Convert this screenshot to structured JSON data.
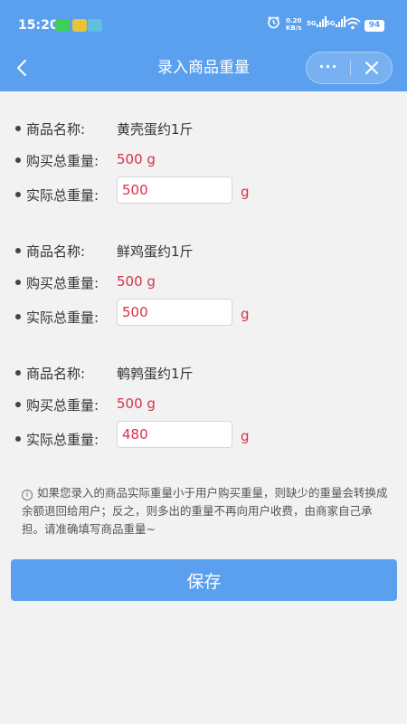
{
  "status_bar": {
    "time": "15:20",
    "speed_value": "0.20",
    "speed_unit": "KB/s",
    "sig1": "5G",
    "sig2": "5G",
    "battery": "94"
  },
  "nav": {
    "title": "录入商品重量",
    "more_label": "···"
  },
  "labels": {
    "name": "商品名称:",
    "bought": "购买总重量:",
    "actual": "实际总重量:",
    "unit": "g"
  },
  "products": [
    {
      "name": "黄壳蛋约1斤",
      "bought": "500 g",
      "actual": "500"
    },
    {
      "name": "鲜鸡蛋约1斤",
      "bought": "500 g",
      "actual": "500"
    },
    {
      "name": "鹌鹑蛋约1斤",
      "bought": "500 g",
      "actual": "480"
    }
  ],
  "notice": {
    "icon": "i",
    "text": "如果您录入的商品实际重量小于用户购买重量，则缺少的重量会转换成余额退回给用户；反之，则多出的重量不再向用户收费，由商家自己承担。请准确填写商品重量~"
  },
  "save_label": "保存",
  "colors": {
    "header": "#5aa0ef",
    "accent_red": "#d6324a",
    "background": "#f2f2f2"
  }
}
